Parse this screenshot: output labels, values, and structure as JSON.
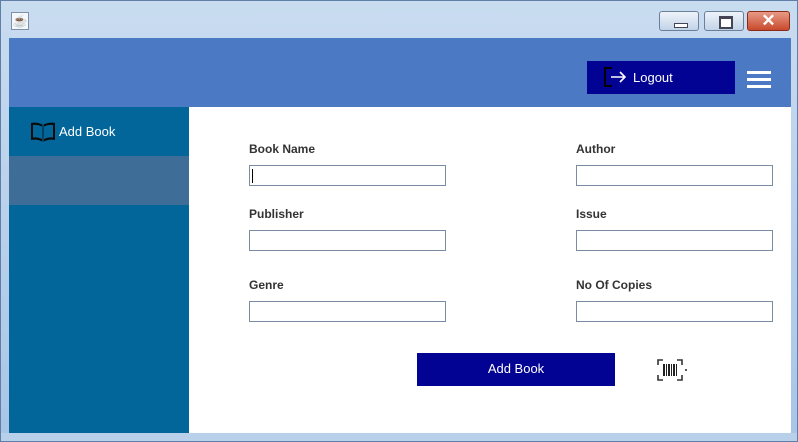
{
  "window": {
    "controls": [
      "minimize",
      "maximize",
      "close"
    ],
    "close_glyph": "✕"
  },
  "header": {
    "logout_label": "Logout",
    "logout_icon": "logout-icon",
    "menu_icon": "hamburger-menu-icon",
    "color": "#4b79c4"
  },
  "sidebar": {
    "items": [
      {
        "label": "Add Book",
        "icon": "open-book-icon"
      },
      {
        "label": ""
      }
    ],
    "color": "#03669a"
  },
  "form": {
    "book_name": {
      "label": "Book Name",
      "value": ""
    },
    "author": {
      "label": "Author",
      "value": ""
    },
    "publisher": {
      "label": "Publisher",
      "value": ""
    },
    "issue": {
      "label": "Issue",
      "value": ""
    },
    "genre": {
      "label": "Genre",
      "value": ""
    },
    "copies": {
      "label": "No Of Copies",
      "value": ""
    },
    "submit_label": "Add Book",
    "barcode_icon": "barcode-scan-icon"
  },
  "colors": {
    "button": "#030393",
    "panel": "#ffffff"
  }
}
